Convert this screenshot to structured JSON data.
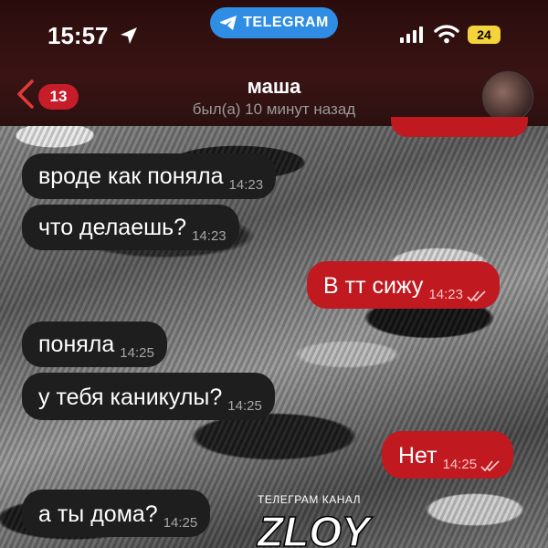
{
  "status_bar": {
    "time": "15:57",
    "app_pill": "TELEGRAM",
    "battery": "24",
    "colors": {
      "pill": "#2f8de4",
      "battery": "#f5d33a"
    }
  },
  "chat_header": {
    "back_badge": "13",
    "name": "маша",
    "status": "был(а) 10 минут назад"
  },
  "messages": [
    {
      "direction": "in",
      "text": "вроде как поняла",
      "time": "14:23"
    },
    {
      "direction": "in",
      "text": "что делаешь?",
      "time": "14:23"
    },
    {
      "direction": "out",
      "text": "В тт сижу",
      "time": "14:23",
      "read": true
    },
    {
      "direction": "in",
      "text": "поняла",
      "time": "14:25"
    },
    {
      "direction": "in",
      "text": "у тебя каникулы?",
      "time": "14:25"
    },
    {
      "direction": "out",
      "text": "Нет",
      "time": "14:25",
      "read": true
    },
    {
      "direction": "in",
      "text": "а ты дома?",
      "time": "14:25"
    }
  ],
  "watermark": {
    "caption": "ТЕЛЕГРАМ КАНАЛ",
    "logo": "ZLOY"
  },
  "colors": {
    "incoming_bubble": "#1e1e1e",
    "outgoing_bubble": "#c01920",
    "header_bg": "#3a1414"
  }
}
